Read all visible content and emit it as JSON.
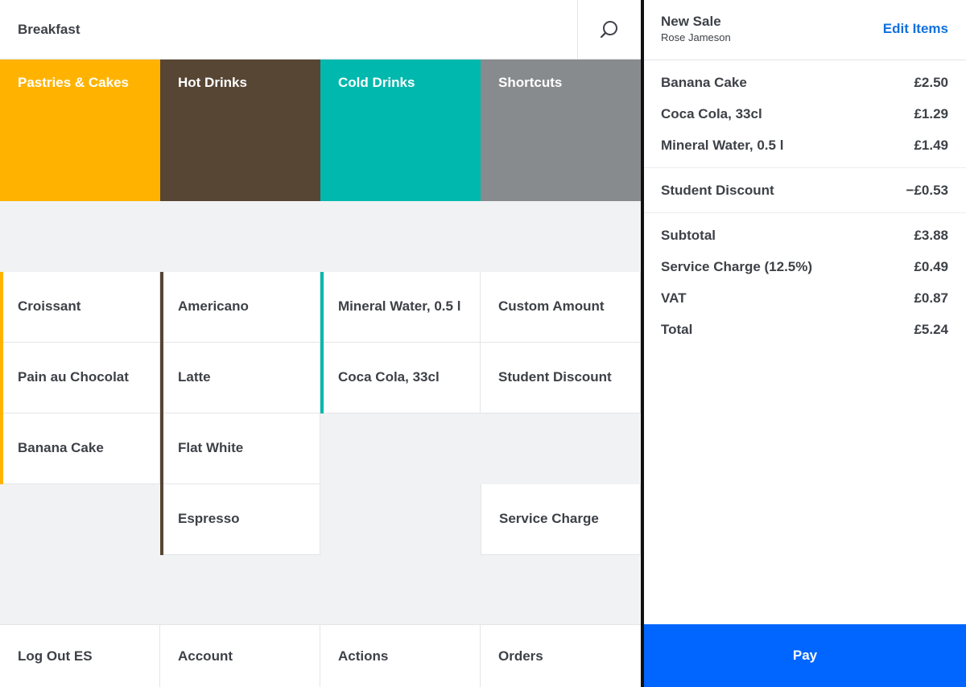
{
  "topbar": {
    "title": "Breakfast"
  },
  "categories": [
    {
      "label": "Pastries & Cakes",
      "color": "#ffb300"
    },
    {
      "label": "Hot Drinks",
      "color": "#574634"
    },
    {
      "label": "Cold Drinks",
      "color": "#00b8ad"
    },
    {
      "label": "Shortcuts",
      "color": "#888b8e"
    }
  ],
  "items": {
    "pastries": [
      "Croissant",
      "Pain au Chocolat",
      "Banana Cake"
    ],
    "hot": [
      "Americano",
      "Latte",
      "Flat White",
      "Espresso"
    ],
    "cold": [
      "Mineral Water, 0.5 l",
      "Coca Cola, 33cl"
    ],
    "shortcuts": [
      "Custom Amount",
      "Student Discount",
      "Service Charge"
    ]
  },
  "bottom_nav": [
    "Log Out ES",
    "Account",
    "Actions",
    "Orders"
  ],
  "sale": {
    "title": "New Sale",
    "customer": "Rose Jameson",
    "edit_label": "Edit Items",
    "lines": [
      {
        "name": "Banana Cake",
        "amount": "£2.50"
      },
      {
        "name": "Coca Cola, 33cl",
        "amount": "£1.29"
      },
      {
        "name": "Mineral Water, 0.5 l",
        "amount": "£1.49"
      }
    ],
    "discount": {
      "name": "Student Discount",
      "amount": "−£0.53"
    },
    "totals": [
      {
        "name": "Subtotal",
        "amount": "£3.88"
      },
      {
        "name": "Service Charge (12.5%)",
        "amount": "£0.49"
      },
      {
        "name": "VAT",
        "amount": "£0.87"
      },
      {
        "name": "Total",
        "amount": "£5.24"
      }
    ],
    "pay_label": "Pay"
  },
  "icons": {
    "search": "search-icon"
  },
  "colors": {
    "accent": "#1170dd",
    "pay": "#0066ff",
    "text": "#3d4147"
  }
}
